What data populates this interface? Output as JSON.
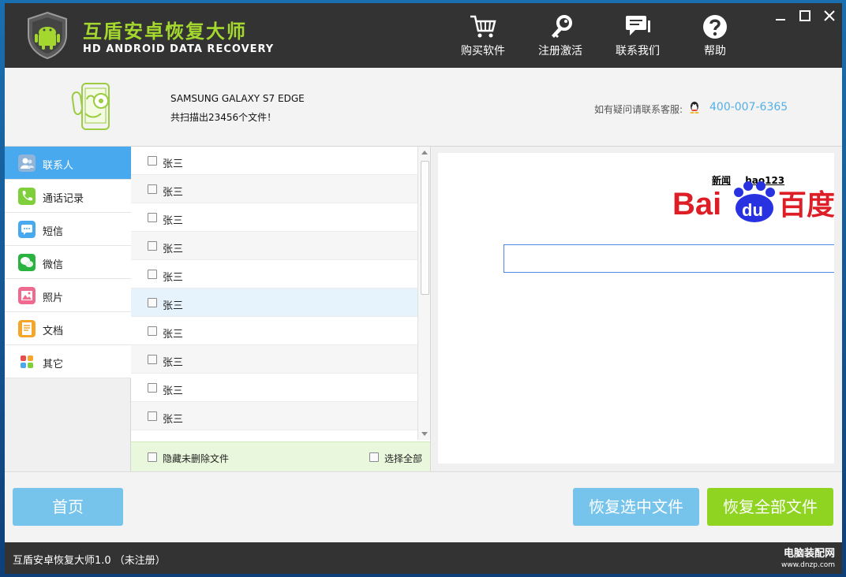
{
  "header": {
    "title": "互盾安卓恢复大师",
    "subtitle": "HD ANDROID DATA RECOVERY",
    "nav": [
      {
        "label": "购买软件",
        "icon": "cart-icon"
      },
      {
        "label": "注册激活",
        "icon": "key-icon"
      },
      {
        "label": "联系我们",
        "icon": "chat-icon"
      },
      {
        "label": "帮助",
        "icon": "help-icon"
      }
    ]
  },
  "device": {
    "name": "SAMSUNG GALAXY S7 EDGE",
    "scan_summary": "共扫描出23456个文件！",
    "support_label": "如有疑问请联系客服:",
    "support_phone": "400-007-6365"
  },
  "sidebar": {
    "items": [
      {
        "label": "联系人",
        "icon": "contacts-icon",
        "color": "#8fb4d8",
        "active": true
      },
      {
        "label": "通话记录",
        "icon": "phone-call-icon",
        "color": "#7fcf3a",
        "active": false
      },
      {
        "label": "短信",
        "icon": "sms-icon",
        "color": "#49a9ee",
        "active": false
      },
      {
        "label": "微信",
        "icon": "wechat-icon",
        "color": "#2ab340",
        "active": false
      },
      {
        "label": "照片",
        "icon": "photo-icon",
        "color": "#f06a8f",
        "active": false
      },
      {
        "label": "文档",
        "icon": "document-icon",
        "color": "#f4a52a",
        "active": false
      },
      {
        "label": "其它",
        "icon": "other-icon",
        "color": "#e84d4d",
        "active": false
      }
    ]
  },
  "list": {
    "rows": [
      "张三",
      "张三",
      "张三",
      "张三",
      "张三",
      "张三",
      "张三",
      "张三",
      "张三",
      "张三"
    ],
    "hide_undeleted_label": "隐藏未删除文件",
    "select_all_label": "选择全部"
  },
  "preview": {
    "links": [
      "新闻",
      "hao123"
    ],
    "logo_text": "Bai百度"
  },
  "buttons": {
    "home": "首页",
    "recover_selected": "恢复选中文件",
    "recover_all": "恢复全部文件"
  },
  "status": {
    "text": "互盾安卓恢复大师1.0 （未注册）",
    "watermark_main": "电脑装配网",
    "watermark_sub": "www.dnzp.com"
  },
  "colors": {
    "accent_blue": "#49a9ee",
    "accent_green": "#8fd420",
    "title_green": "#a4d82f",
    "header_bg": "#333333"
  }
}
